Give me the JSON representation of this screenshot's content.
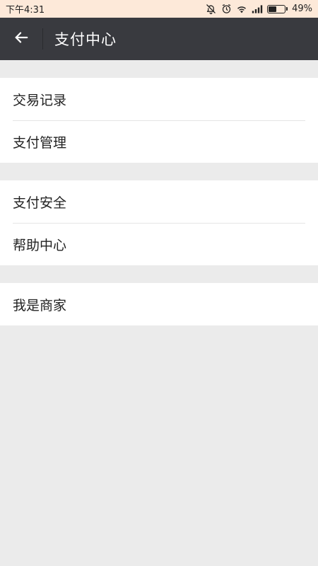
{
  "status_bar": {
    "time": "下午4:31",
    "battery_percent": "49%",
    "battery_level": 0.49,
    "icons": [
      "bell-muted-icon",
      "alarm-icon",
      "wifi-icon",
      "signal-icon",
      "battery-icon"
    ]
  },
  "app_bar": {
    "title": "支付中心",
    "back_icon": "arrow-left-icon",
    "background": "#393a3f"
  },
  "groups": [
    {
      "items": [
        {
          "label": "交易记录"
        },
        {
          "label": "支付管理"
        }
      ]
    },
    {
      "items": [
        {
          "label": "支付安全"
        },
        {
          "label": "帮助中心"
        }
      ]
    },
    {
      "items": [
        {
          "label": "我是商家"
        }
      ]
    }
  ],
  "colors": {
    "status_bar_bg": "#fde9d9",
    "page_bg": "#ebebeb",
    "cell_bg": "#ffffff",
    "text": "#222222"
  }
}
